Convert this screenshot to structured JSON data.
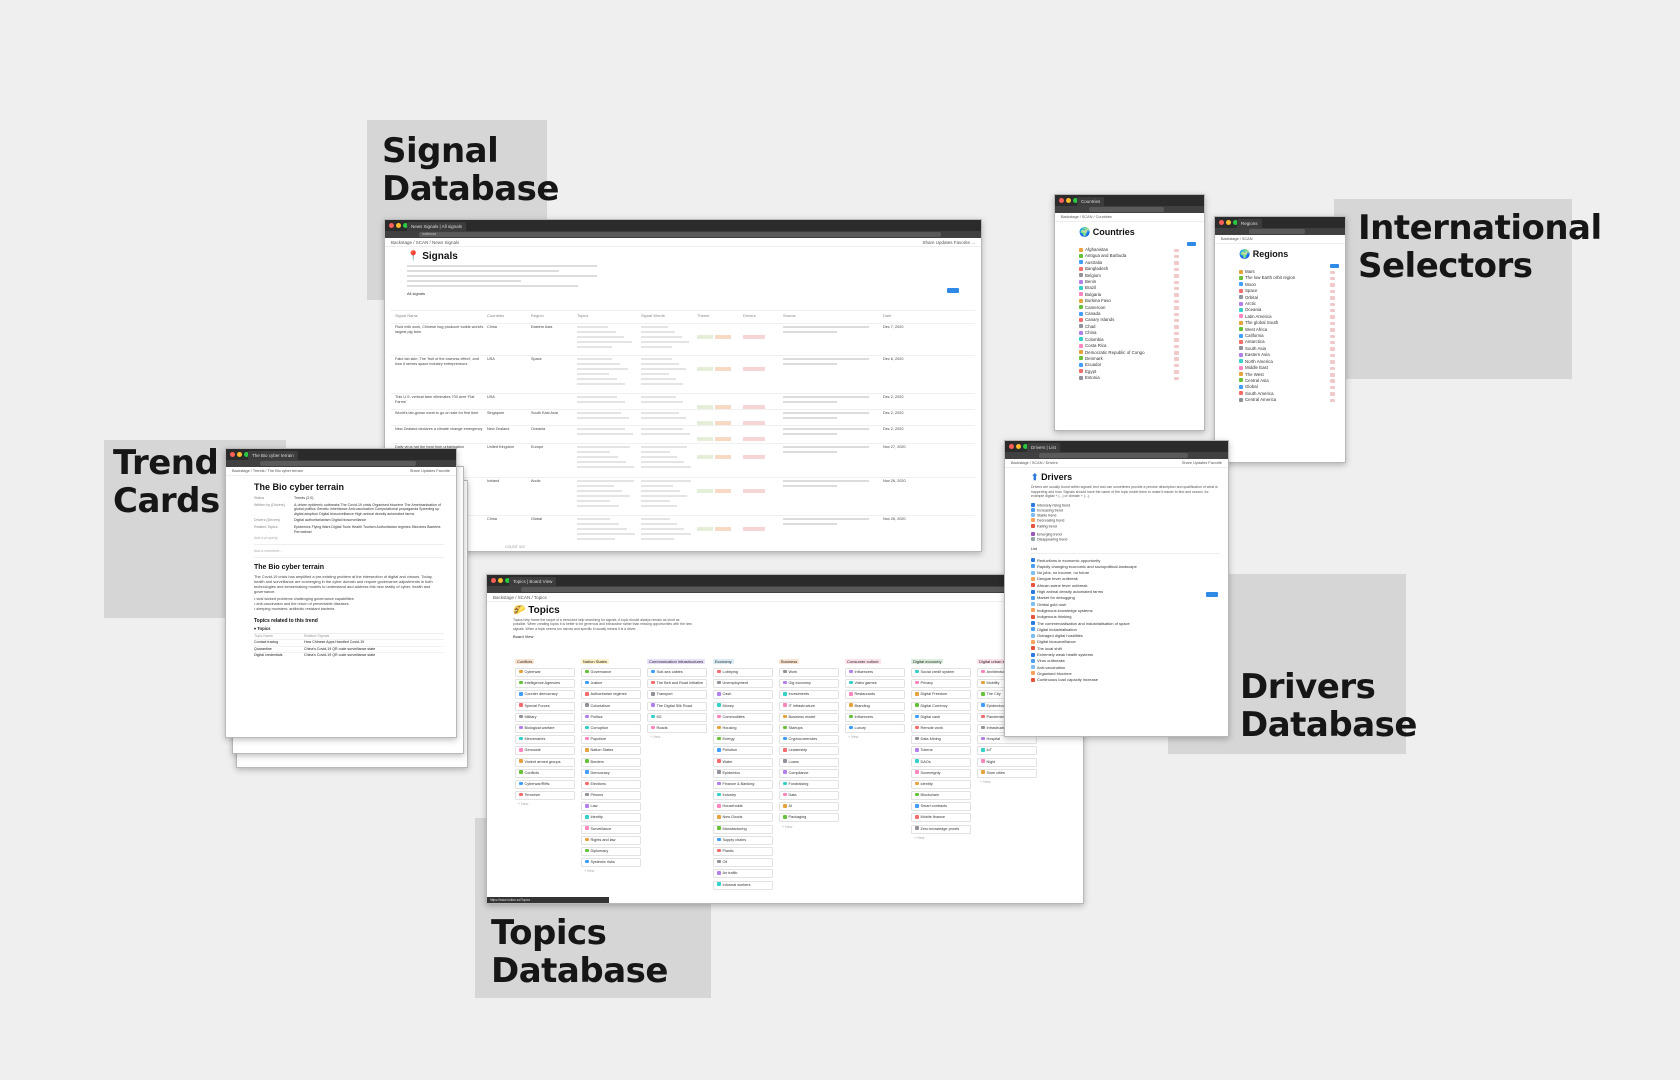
{
  "labels": {
    "signal": [
      "Signal",
      "Database"
    ],
    "international": [
      "International",
      "Selectors"
    ],
    "trend": [
      "Trend",
      "Cards"
    ],
    "drivers": [
      "Drivers",
      "Database"
    ],
    "topics": [
      "Topics",
      "Database"
    ]
  },
  "signals_window": {
    "tab": "News Signals | All signals",
    "url": "notion.so",
    "crumbs": "Backstage / SCAN / News Signals",
    "crumbs_right": "Share  Updates  Favorite  ...",
    "title": "Signals",
    "view": "All signals",
    "columns": [
      "Signal Name",
      "Countries",
      "Region",
      "Topics",
      "Signal Words",
      "Theme",
      "Drivers",
      "Source",
      "Date"
    ],
    "rows": [
      {
        "name": "Fluid milk work, Chinese hog producer builds world's largest pig farm",
        "country": "China",
        "region": "Eastern Asia",
        "date": "Dec 7, 2020"
      },
      {
        "name": "Fake lab skin: The 'fruit of the lowness effect', and how it serves space industry entrepreneurs",
        "country": "USA",
        "region": "Space",
        "date": "Dec 6, 2020"
      },
      {
        "name": "This U.S. vertical farm eliminates 700 acre 'Flat Farms'",
        "country": "USA",
        "region": "",
        "date": "Dec 2, 2020"
      },
      {
        "name": "World's lab-grown meat to go on sale for first time",
        "country": "Singapore",
        "region": "South East Asia",
        "date": "Dec 2, 2020"
      },
      {
        "name": "New Zealand declares a climate change emergency",
        "country": "New Zealand",
        "region": "Oceania",
        "date": "Dec 2, 2020"
      },
      {
        "name": "Daily virus hat the heat from urbanisation",
        "country": "United Kingdom",
        "region": "Europe",
        "date": "Nov 27, 2020"
      },
      {
        "name": "Microbes are shaking up",
        "country": "Iceland",
        "region": "Arctic",
        "date": "Nov 26, 2020"
      },
      {
        "name": "Chinese QR code based global travel",
        "country": "China",
        "region": "Global",
        "date": "Nov 26, 2020"
      }
    ],
    "footer": "COUNT 423"
  },
  "countries_window": {
    "tab": "Countries",
    "crumbs": "Backstage / SCAN / Countries",
    "crumbs_right": "Share  Updates  Favorite",
    "title": "Countries",
    "items": [
      "Afghanistan",
      "Antigua and Barbuda",
      "Australia",
      "Bangladesh",
      "Belgium",
      "Benin",
      "Brazil",
      "Bulgaria",
      "Burkina Faso",
      "Cameroon",
      "Canada",
      "Canary Islands",
      "Chad",
      "China",
      "Colombia",
      "Costa Rica",
      "Democratic Republic of Congo",
      "Denmark",
      "Ecuador",
      "Egypt",
      "Estonia"
    ]
  },
  "regions_window": {
    "tab": "Regions",
    "crumbs": "Backstage / SCAN",
    "crumbs_right": "Share  Updates  Favorite",
    "title": "Regions",
    "items": [
      "Mars",
      "The low Earth orbit region",
      "Moon",
      "Space",
      "Orbital",
      "Arctic",
      "Oceania",
      "Latin America",
      "The global South",
      "West Africa",
      "California",
      "Antarctica",
      "South Asia",
      "Eastern Asia",
      "North America",
      "Middle East",
      "The West",
      "Central Asia",
      "Global",
      "South America",
      "Central America"
    ]
  },
  "trend_window": {
    "tab": "The Bio cyber terrain",
    "crumbs": "Backstage / Trends / The Bio cyber terrain",
    "crumbs_right": "Share  Updates  Favorite",
    "title": "The Bio cyber terrain",
    "props": [
      {
        "k": "Status",
        "v": "Trends (2.0)"
      },
      {
        "k": "Written by (Drivers)",
        "v": "A-driven epidemic outbreaks  The Covid-19 crisis  Organised biocrime  The Americanisation of global politics  Genetic inheritance  Anti-vaccination  Computational propaganda  Speeding up digital adoption  Digital biosurveillance  High animal density automated farms"
      },
      {
        "k": "Drivers (Drivers)",
        "v": "Digital authoritarianism  Digital biosurveillance"
      },
      {
        "k": "Related Topics",
        "v": "Epidemics  Flying  Wars  Digital Tools  Health  Tourism  Authoritarian regimes  Microbes  Bacteria  Permafrost"
      }
    ],
    "add_property": "Add a property",
    "add_comment": "Add a comment...",
    "heading": "The Bio cyber terrain",
    "body": "The Covid-19 crisis has amplified a pre-existing problem at the intersection of digital and viruses. Today, health and surveillance are converging in the cyber domain and require governance adjustments in both technologies and sensemaking models to understand and address this new reality of cyber, health and governance.",
    "bullets": [
      "viral wicked problems challenging governance capabilities",
      "anti-vaccination and the return of preventable diseases",
      "sleeping monsters: antibiotic resistant bacteria"
    ],
    "related_heading": "Topics related to this trend",
    "toggle": "Topics",
    "table_cols": [
      "Topic Name",
      "Related Signals"
    ],
    "table_rows": [
      [
        "Contact tracing",
        "How Chinese Apps Handled Covid-19"
      ],
      [
        "Quarantine",
        "China's Covid-19 QR code surveillance state"
      ],
      [
        "Digital credentials",
        "China's Covid-19 QR code surveillance state"
      ]
    ]
  },
  "drivers_window": {
    "tab": "Drivers | List",
    "crumbs": "Backstage / SCAN / Drivers",
    "crumbs_right": "Share  Updates  Favorite",
    "title": "Drivers",
    "desc": "Drivers are usually found within signals' text and can sometimes provide a precise description and qualification of what is happening and how. Signals should have the name of the topic inside them to make it easier to find and search, for example digital + (...) or climate + (...).",
    "legend": [
      "Intensely rising trend",
      "Increasing trend",
      "Stable trend",
      "Decreasing trend",
      "Falling trend",
      "Emerging trend",
      "Disappearing trend"
    ],
    "view": "List",
    "items": [
      "Reductions in economic opportunity",
      "Rapidly changing economic and sociopolitical landscape",
      "No jobs, no income, no future",
      "Dengue fever outbreak",
      "African swine fever outbreak",
      "High animal density automated farms",
      "Market for debugging",
      "Orbital gold rush",
      "Indigenous knowledge systems",
      "Indigenous thinking",
      "The commercialisation and industrialisation of space",
      "Digital industrialisation",
      "Outraged digital hostilities",
      "Digital biosurveillance",
      "The local shift",
      "Extremely weak health systems",
      "Virus outbreaks",
      "Anti-vaccination",
      "Organised biocrime",
      "Continuous load capacity increase"
    ]
  },
  "topics_window": {
    "tab": "Topics | Board View",
    "crumbs": "Backstage / SCAN / Topics",
    "crumbs_right": "Share  Updates  Favorite",
    "title": "Topics",
    "desc": "Topics help frame the scope of a trend and help searching for signals. A topic should always remain as short as possible. When creating topics it is better to be generous and exhaustive rather than missing opportunities with the new signals. When a topic seems too narrow and specific it usually means it is a driver.",
    "view": "Board View",
    "status_url": "https://www.notion.so/Topics",
    "columns": [
      {
        "name": "Conflicts",
        "color": "#fbe4d1",
        "cards": [
          "Cyberwar",
          "Intelligence Agencies",
          "Counter democracy",
          "Special Forces",
          "Military",
          "Biological warfare",
          "Mercenaries",
          "Genocide",
          "Violent armed groups",
          "Conflicts",
          "Cyberwar/Rifts",
          "Terrorism"
        ]
      },
      {
        "name": "Nation States",
        "color": "#fdf2c7",
        "cards": [
          "Governance",
          "Justice",
          "Authoritarian regimes",
          "Colonialism",
          "Politics",
          "Corruption",
          "Populism",
          "Nation States",
          "Borders",
          "Democracy",
          "Elections",
          "Prisons",
          "Law",
          "Identity",
          "Surveillance",
          "Rights and law",
          "Diplomacy",
          "Systemic risks"
        ]
      },
      {
        "name": "Communication infrastructures",
        "color": "#e8dffa",
        "cards": [
          "Sub-sea cables",
          "The Belt and Road Initiative",
          "Transport",
          "The Digital Silk Road",
          "5G",
          "Roads"
        ]
      },
      {
        "name": "Economy",
        "color": "#dcecf7",
        "cards": [
          "Lobbying",
          "Unemployment",
          "Cash",
          "Money",
          "Commodities",
          "Housing",
          "Energy",
          "Pollution",
          "Water",
          "Epidemics",
          "Finance & Banking",
          "Industry",
          "Households",
          "New Goods",
          "Manufacturing",
          "Supply chains",
          "Plastic",
          "Oil",
          "Air traffic",
          "Informal workers",
          "Tourism"
        ]
      },
      {
        "name": "Business",
        "color": "#fbe4d1",
        "cards": [
          "Work",
          "Gig economy",
          "Investments",
          "IT infrastructure",
          "Business model",
          "Startups",
          "Cryptocurrencies",
          "Leadership",
          "Loans",
          "Compliance",
          "Fundraising",
          "Data",
          "AI",
          "Packaging"
        ]
      },
      {
        "name": "Consumer culture",
        "color": "#fde0ea",
        "cards": [
          "Influencers",
          "Video games",
          "Restaurants",
          "Branding",
          "Influencers",
          "Luxury"
        ]
      },
      {
        "name": "Digital economy",
        "color": "#dceedd",
        "cards": [
          "Social credit system",
          "Privacy",
          "Digital Freedom",
          "Digital Currency",
          "Digital cash",
          "Remote work",
          "Data Mining",
          "Tokens",
          "DAOs",
          "Sovereignty",
          "Identity",
          "Blockchain",
          "Smart contracts",
          "Mobile finance",
          "Zero knowledge proofs"
        ]
      },
      {
        "name": "Digital urban environments",
        "color": "#fde0ea",
        "cards": [
          "Architecture",
          "Mobility",
          "The City",
          "Epidemics",
          "Pandemics",
          "Infrastructure",
          "Hospital",
          "IoT",
          "Night",
          "Slum cities"
        ]
      }
    ],
    "new_label": "+ New"
  }
}
